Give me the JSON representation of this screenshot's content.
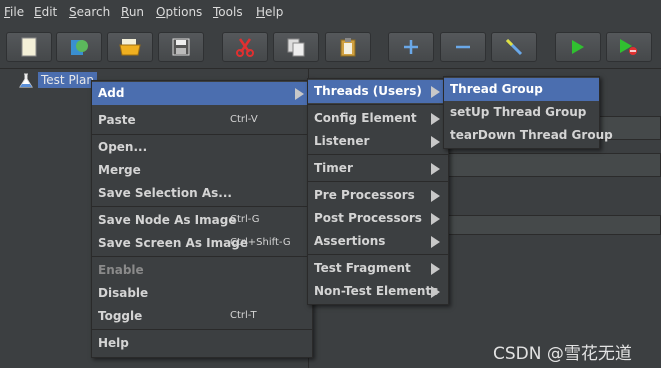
{
  "menubar": [
    "File",
    "Edit",
    "Search",
    "Run",
    "Options",
    "Tools",
    "Help"
  ],
  "toolbar": {
    "buttons": [
      "new-icon",
      "templates-icon",
      "open-icon",
      "save-icon",
      "cut-icon",
      "copy-icon",
      "paste-icon",
      "expand-icon",
      "collapse-icon",
      "toggle-icon",
      "start-icon",
      "start-no-pauses-icon"
    ]
  },
  "tree": {
    "root_label": "Test Plan"
  },
  "context_menu": {
    "items": [
      {
        "label": "Add",
        "shortcut": "",
        "submenu": true
      },
      {
        "label": "Paste",
        "shortcut": "Ctrl-V"
      },
      {
        "label": "Open..."
      },
      {
        "label": "Merge"
      },
      {
        "label": "Save Selection As..."
      },
      {
        "label": "Save Node As Image",
        "shortcut": "Ctrl-G"
      },
      {
        "label": "Save Screen As Image",
        "shortcut": "Ctrl+Shift-G"
      },
      {
        "label": "Enable",
        "disabled": true
      },
      {
        "label": "Disable"
      },
      {
        "label": "Toggle",
        "shortcut": "Ctrl-T"
      },
      {
        "label": "Help"
      }
    ]
  },
  "add_submenu": {
    "items": [
      {
        "label": "Threads (Users)"
      },
      {
        "label": "Config Element"
      },
      {
        "label": "Listener"
      },
      {
        "label": "Timer"
      },
      {
        "label": "Pre Processors"
      },
      {
        "label": "Post Processors"
      },
      {
        "label": "Assertions"
      },
      {
        "label": "Test Fragment"
      },
      {
        "label": "Non-Test Elements"
      }
    ]
  },
  "threads_submenu": {
    "items": [
      {
        "label": "Thread Group"
      },
      {
        "label": "setUp Thread Group"
      },
      {
        "label": "tearDown Thread Group"
      }
    ]
  },
  "watermark": "CSDN @雪花无道",
  "colors": {
    "highlight": "#4b6eaf",
    "background": "#3c3f41"
  }
}
